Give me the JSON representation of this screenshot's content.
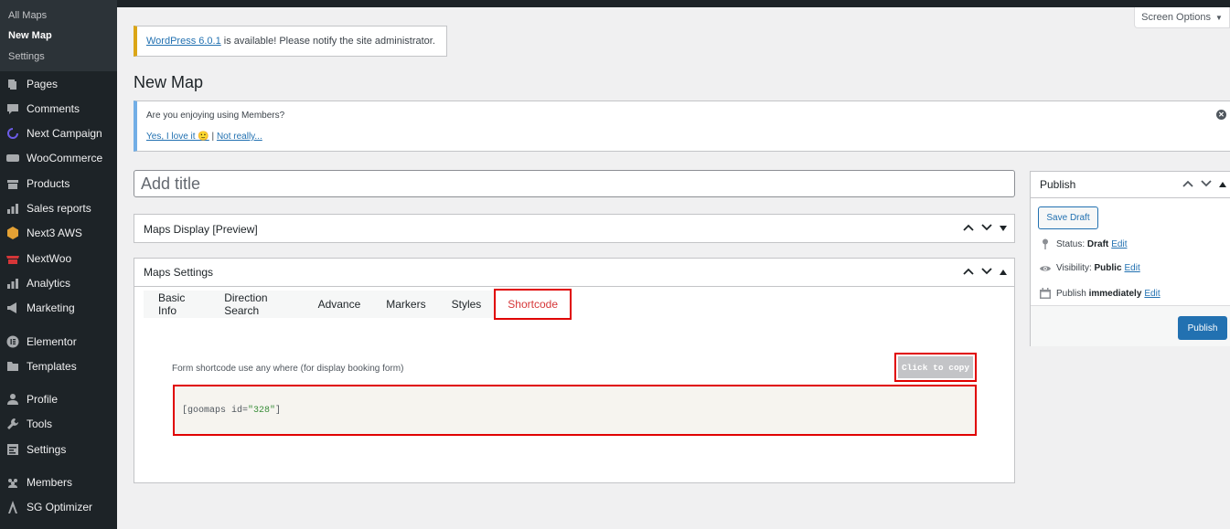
{
  "sidebar": {
    "submenu": [
      {
        "label": "All Maps",
        "current": false
      },
      {
        "label": "New Map",
        "current": true
      },
      {
        "label": "Settings",
        "current": false
      }
    ],
    "items": [
      {
        "label": "Pages",
        "icon": "pages-icon"
      },
      {
        "label": "Comments",
        "icon": "comments-icon"
      },
      {
        "label": "Next Campaign",
        "icon": "campaign-icon"
      },
      {
        "label": "WooCommerce",
        "icon": "woocommerce-icon"
      },
      {
        "label": "Products",
        "icon": "products-icon"
      },
      {
        "label": "Sales reports",
        "icon": "reports-icon"
      },
      {
        "label": "Next3 AWS",
        "icon": "aws-icon"
      },
      {
        "label": "NextWoo",
        "icon": "store-icon"
      },
      {
        "label": "Analytics",
        "icon": "analytics-icon"
      },
      {
        "label": "Marketing",
        "icon": "megaphone-icon"
      },
      {
        "label": "Elementor",
        "icon": "elementor-icon"
      },
      {
        "label": "Templates",
        "icon": "folder-icon"
      },
      {
        "label": "Profile",
        "icon": "user-icon"
      },
      {
        "label": "Tools",
        "icon": "wrench-icon"
      },
      {
        "label": "Settings",
        "icon": "settings-icon"
      },
      {
        "label": "Members",
        "icon": "members-icon"
      },
      {
        "label": "SG Optimizer",
        "icon": "sg-optimizer-icon"
      }
    ]
  },
  "screen_options": {
    "label": "Screen Options",
    "arrow": "▼"
  },
  "update_notice": {
    "link": "WordPress 6.0.1",
    "text": " is available! Please notify the site administrator."
  },
  "page_title": "New Map",
  "members_notice": {
    "question": "Are you enjoying using Members?",
    "yes_link": "Yes, I love it 🙂",
    "separator": " | ",
    "no_link": "Not really..."
  },
  "title_input": {
    "placeholder": "Add title",
    "value": ""
  },
  "maps_display": {
    "title": "Maps Display [Preview]"
  },
  "maps_settings": {
    "title": "Maps Settings",
    "tabs": [
      "Basic Info",
      "Direction Search",
      "Advance",
      "Markers",
      "Styles",
      "Shortcode"
    ],
    "active_tab": "Shortcode",
    "shortcode_label": "Form shortcode use any where (for display booking form)",
    "copy_button": "Click to copy",
    "shortcode_prefix": "[goomaps id=",
    "shortcode_value": "\"328\"",
    "shortcode_suffix": "]"
  },
  "publish": {
    "title": "Publish",
    "save_draft": "Save Draft",
    "status_label": "Status: ",
    "status_value": "Draft",
    "visibility_label": "Visibility: ",
    "visibility_value": "Public",
    "schedule_label": "Publish ",
    "schedule_value": "immediately",
    "edit_link": "Edit",
    "publish_button": "Publish"
  },
  "colors": {
    "admin_dark": "#1d2327",
    "link": "#2271b1",
    "highlight_red": "#e00000",
    "notice_warning": "#dba617",
    "notice_info": "#72aee6"
  }
}
